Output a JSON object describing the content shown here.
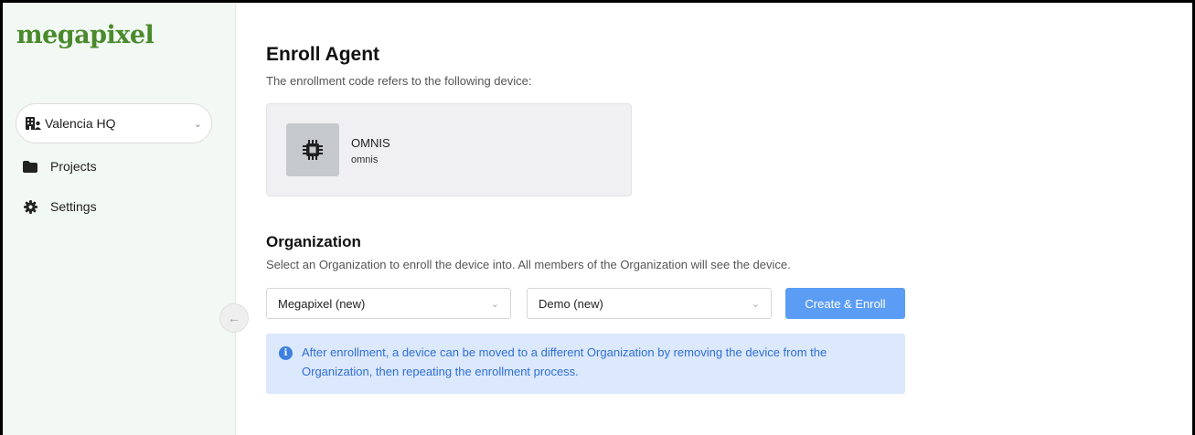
{
  "sidebar": {
    "logo": "megapixel",
    "workspace": {
      "label": "Valencia HQ",
      "icon": "building-user-icon"
    },
    "items": [
      {
        "label": "Projects",
        "icon": "folder-icon"
      },
      {
        "label": "Settings",
        "icon": "gear-icon"
      }
    ],
    "collapse_icon": "arrow-left-icon"
  },
  "main": {
    "title": "Enroll Agent",
    "subtitle": "The enrollment code refers to the following device:",
    "device": {
      "name": "OMNIS",
      "id": "omnis",
      "icon": "chip-icon"
    },
    "organization": {
      "title": "Organization",
      "description": "Select an Organization to enroll the device into. All members of the Organization will see the device.",
      "org_select": "Megapixel (new)",
      "project_select": "Demo (new)",
      "button": "Create & Enroll"
    },
    "info": {
      "icon": "info-icon",
      "text": "After enrollment, a device can be moved to a different Organization by removing the device from the Organization, then repeating the enrollment process."
    }
  },
  "colors": {
    "accent": "#5b9df5",
    "logo": "#4a8a2c",
    "sidebar_bg": "#f2f8f3",
    "info_bg": "#dce8fb",
    "info_text": "#2f6fd6"
  }
}
